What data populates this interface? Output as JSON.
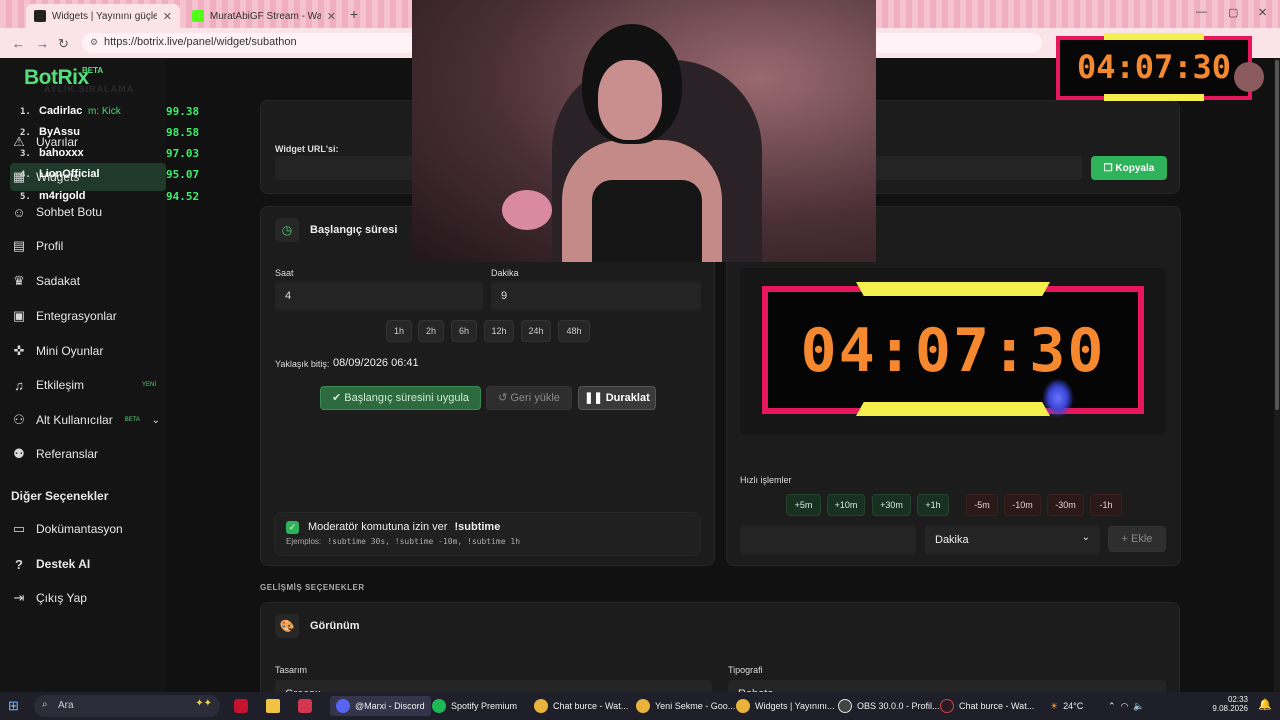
{
  "browser": {
    "tabs": [
      {
        "label": "Widgets | Yayınını güçlendirme",
        "active": true
      },
      {
        "label": "MuratAbiGF Stream - Watch Li",
        "active": false
      }
    ],
    "url": "https://botrix.live/panel/widget/subathon"
  },
  "app": {
    "name": "BotRix",
    "beta": "BETA"
  },
  "leaderboard": {
    "title": "AYLIK SIRALAMA",
    "subtitle": "m: Kick",
    "rows": [
      {
        "rank": "1.",
        "name": "Cadirlac",
        "score": "99.38"
      },
      {
        "rank": "2.",
        "name": "ByAssu",
        "score": "98.58"
      },
      {
        "rank": "3.",
        "name": "bahoxxx",
        "score": "97.03"
      },
      {
        "rank": "4.",
        "name": "LionOfficial",
        "score": "95.07"
      },
      {
        "rank": "5.",
        "name": "m4rigold",
        "score": "94.52"
      }
    ]
  },
  "sidebar": {
    "items": [
      {
        "label": "Uyarılar"
      },
      {
        "label": "Widgets"
      },
      {
        "label": "Sohbet Botu"
      },
      {
        "label": "Profil"
      },
      {
        "label": "Sadakat"
      },
      {
        "label": "Entegrasyonlar"
      },
      {
        "label": "Mini Oyunlar"
      },
      {
        "label": "Etkileşim",
        "badge": "YENİ"
      },
      {
        "label": "Alt Kullanıcılar",
        "badge": "BETA"
      },
      {
        "label": "Referanslar"
      }
    ],
    "other_title": "Diğer Seçenekler",
    "other_items": [
      {
        "label": "Dokümantasyon"
      },
      {
        "label": "Destek AI"
      },
      {
        "label": "Çıkış Yap"
      }
    ]
  },
  "widget_url": {
    "label": "Widget URL'si:",
    "copy_label": "Kopyala"
  },
  "start_time": {
    "title": "Başlangıç süresi",
    "hours_label": "Saat",
    "hours_value": "4",
    "minutes_label": "Dakika",
    "minutes_value": "9",
    "presets": [
      "1h",
      "2h",
      "6h",
      "12h",
      "24h",
      "48h"
    ],
    "approx_end_label": "Yaklaşık bitiş:",
    "approx_end_value": "08/09/2026 06:41",
    "apply_label": "Başlangıç süresini uygula",
    "reset_label": "Geri yükle",
    "pause_label": "Duraklat"
  },
  "moderator": {
    "label": "Moderatör komutuna izin ver",
    "command": "!subtime",
    "examples_label": "Ejemplos:",
    "examples": "!subtime 30s, !subtime -10m, !subtime 1h"
  },
  "timer": {
    "display": "04:07:30"
  },
  "quick_actions": {
    "label": "Hızlı işlemler",
    "add": [
      "+5m",
      "+10m",
      "+30m",
      "+1h"
    ],
    "sub": [
      "-5m",
      "-10m",
      "-30m",
      "-1h"
    ],
    "unit_value": "Dakika",
    "add_label": "Ekle"
  },
  "advanced": {
    "section_title": "GELİŞMİŞ SEÇENEKLER",
    "appearance_title": "Görünüm",
    "design_label": "Tasarım",
    "design_value": "Grecox",
    "typography_label": "Tipografi",
    "typography_value": "Roboto"
  },
  "taskbar": {
    "search_placeholder": "Ara",
    "items": [
      "@Marxi - Discord",
      "Spotify Premium",
      "Chat burce - Wat...",
      "Yeni Sekme - Goo...",
      "Widgets | Yayınını...",
      "OBS 30.0.0 - Profil...",
      "Chat burce - Wat..."
    ],
    "temperature": "24°C",
    "time": "02:33",
    "date": "9.08.2026"
  },
  "colors": {
    "accent": "#2fb35a",
    "timer_frame": "#e8175d",
    "timer_bar": "#f4ef4c",
    "timer_digits": "#f6882f"
  }
}
